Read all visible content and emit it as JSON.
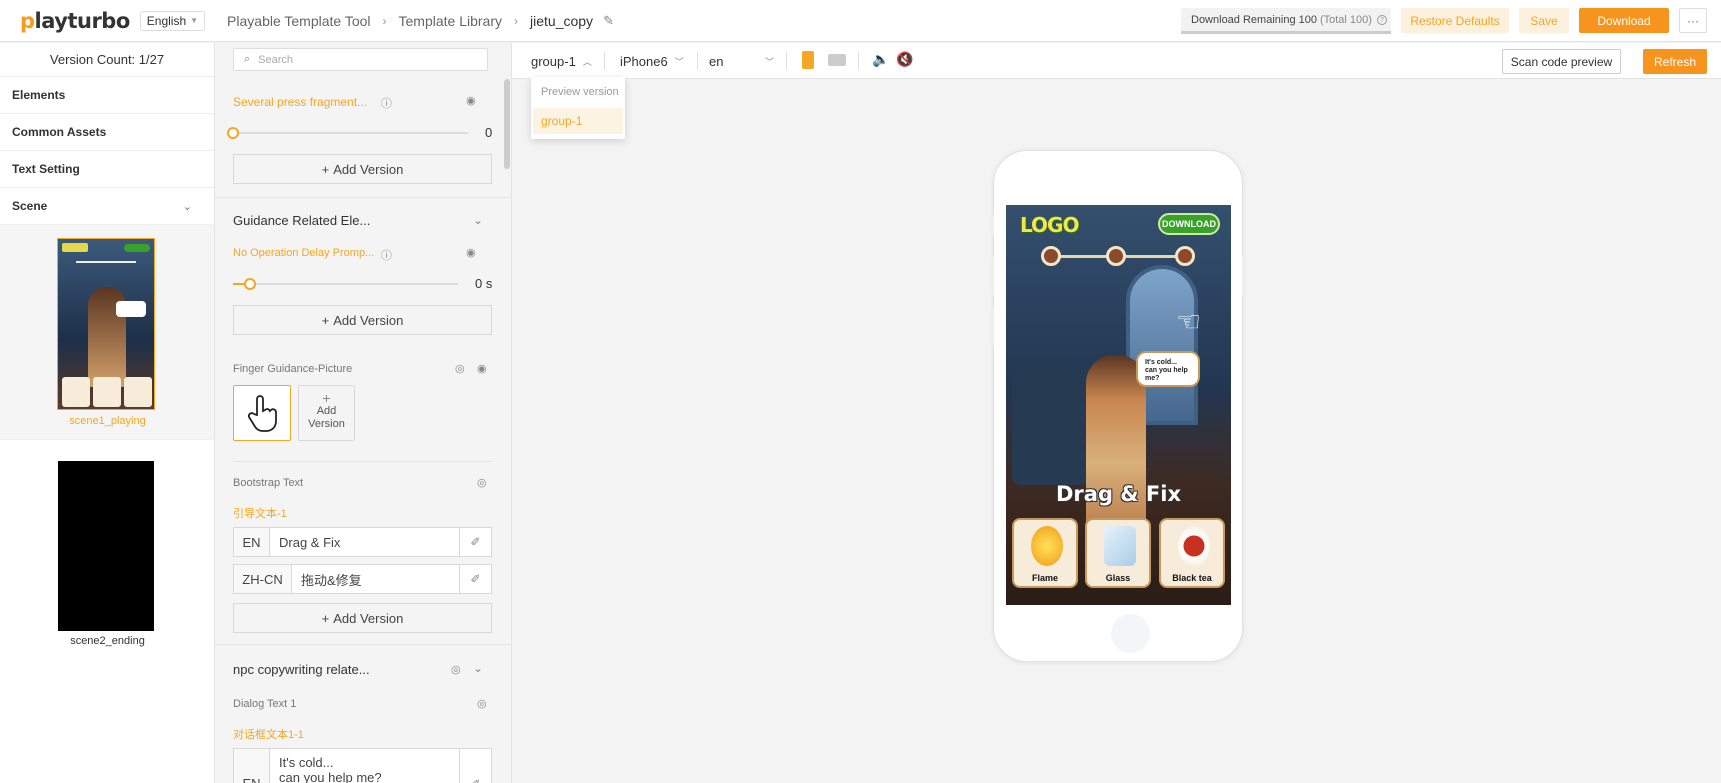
{
  "header": {
    "logo_text": "playturbo",
    "language": "English",
    "breadcrumbs": [
      "Playable Template Tool",
      "Template Library",
      "jietu_copy"
    ],
    "quota_text": "Download Remaining 100",
    "quota_total": "(Total 100)",
    "restore_label": "Restore Defaults",
    "save_label": "Save",
    "download_label": "Download",
    "more_label": "···"
  },
  "sidebar": {
    "version_count": "Version Count: 1/27",
    "items": [
      "Elements",
      "Common Assets",
      "Text Setting",
      "Scene"
    ],
    "scenes": [
      "scene1_playing",
      "scene2_ending"
    ]
  },
  "panel": {
    "search_placeholder": "Search",
    "fragment_title": "Several press fragment...",
    "fragment_value": "0",
    "add_version": "Add Version",
    "guidance_title": "Guidance Related Ele...",
    "delay_title": "No Operation Delay Promp...",
    "delay_value": "0 s",
    "finger_title": "Finger Guidance-Picture",
    "add_version_short": [
      "Add",
      "Version"
    ],
    "bootstrap_title": "Bootstrap Text",
    "bootstrap_key": "引导文本-1",
    "texts": [
      {
        "lang": "EN",
        "value": "Drag & Fix"
      },
      {
        "lang": "ZH-CN",
        "value": "拖动&修复"
      }
    ],
    "npc_title": "npc copywriting relate...",
    "dialog_title": "Dialog Text 1",
    "dialog_key": "对话框文本1-1",
    "dialog_lang": "EN",
    "dialog_line1": "It's cold...",
    "dialog_line2": "can you help me?"
  },
  "toolbar": {
    "group": "group-1",
    "device": "iPhone6",
    "lang": "en",
    "scan_label": "Scan code preview",
    "refresh_label": "Refresh"
  },
  "dropdown": {
    "header": "Preview version",
    "option": "group-1"
  },
  "game": {
    "logo": "LOGO",
    "download": "DOWNLOAD",
    "bubble_line1": "It's cold...",
    "bubble_line2": "can you help me?",
    "title": "Drag & Fix",
    "cards": [
      "Flame",
      "Glass",
      "Black tea"
    ]
  },
  "colors": {
    "accent": "#f5a623",
    "accent_strong": "#f7941d"
  },
  "icons": [
    "chevron-down-icon",
    "help-icon",
    "visibility-icon",
    "eye-icon",
    "search-icon",
    "pencil-icon",
    "brush-icon",
    "speaker-icon",
    "mute-icon",
    "hand-pointer-icon"
  ]
}
